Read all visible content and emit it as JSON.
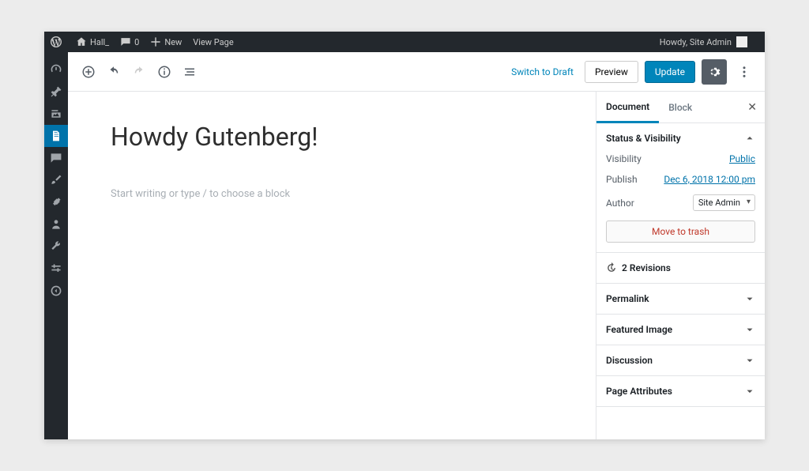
{
  "adminbar": {
    "site_name": "Hall_",
    "comments_count": "0",
    "new_label": "New",
    "view_page": "View Page",
    "howdy": "Howdy, Site Admin"
  },
  "toolbar": {
    "switch_to_draft": "Switch to Draft",
    "preview": "Preview",
    "update": "Update"
  },
  "post": {
    "title": "Howdy Gutenberg!",
    "placeholder": "Start writing or type / to choose a block"
  },
  "sidebar": {
    "tabs": {
      "document": "Document",
      "block": "Block"
    },
    "panels": {
      "status": {
        "title": "Status & Visibility",
        "visibility_label": "Visibility",
        "visibility_value": "Public",
        "publish_label": "Publish",
        "publish_value": "Dec 6, 2018 12:00 pm",
        "author_label": "Author",
        "author_value": "Site Admin",
        "trash": "Move to trash"
      },
      "revisions": "2 Revisions",
      "permalink": "Permalink",
      "featured_image": "Featured Image",
      "discussion": "Discussion",
      "page_attributes": "Page Attributes"
    }
  }
}
